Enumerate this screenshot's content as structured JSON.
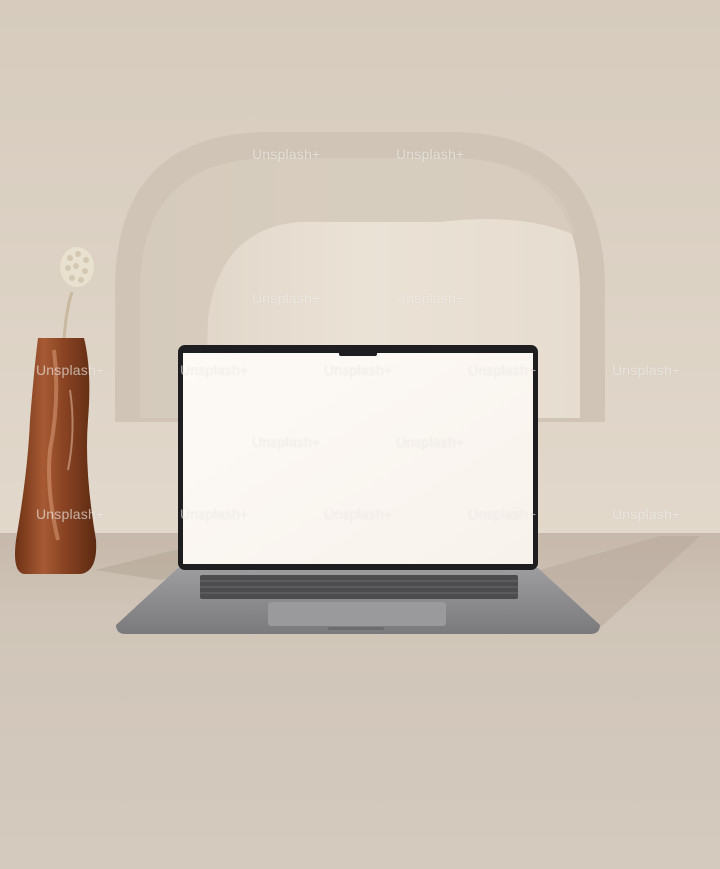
{
  "watermark": {
    "text": "Unsplash+"
  },
  "colors": {
    "wall": "#d9cfc2",
    "floor": "#cfc4b7",
    "niche_back": "#e8dfd2",
    "vase": "#8e4a28",
    "screen": "#fbf6f1",
    "laptop_body": "#8d8d8f"
  }
}
